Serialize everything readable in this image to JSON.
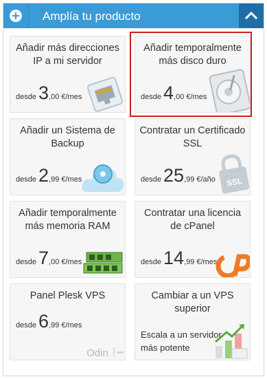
{
  "header": {
    "title": "Amplía tu producto",
    "add_icon": "plus-icon",
    "toggle_icon": "chevron-up-icon",
    "color": "#3b9bd6",
    "toggle_color": "#1f6ea8"
  },
  "highlight_color": "#c9201f",
  "cards": [
    {
      "title": "Añadir más direcciones IP a mi servidor",
      "prefix": "desde",
      "price_int": "3",
      "price_suffix": ",00 €/mes",
      "icon": "network-port-icon"
    },
    {
      "title": "Añadir temporalmente más disco duro",
      "prefix": "desde",
      "price_int": "4",
      "price_suffix": ",00 €/mes",
      "icon": "hard-disk-icon",
      "selected": true
    },
    {
      "title": "Añadir un Sistema de Backup",
      "prefix": "desde",
      "price_int": "2",
      "price_suffix": ",99 €/mes",
      "icon": "cloud-backup-icon"
    },
    {
      "title": "Contratar un Certificado SSL",
      "prefix": "desde",
      "price_int": "25",
      "price_suffix": ",99 €/año",
      "icon": "ssl-lock-icon"
    },
    {
      "title": "Añadir temporalmente más memoria RAM",
      "prefix": "desde",
      "price_int": "7",
      "price_suffix": ",00 €/mes",
      "icon": "ram-module-icon"
    },
    {
      "title": "Contratar una licencia de cPanel",
      "prefix": "desde",
      "price_int": "14",
      "price_suffix": ",99 €/mes",
      "icon": "cpanel-logo-icon"
    },
    {
      "title": "Panel Plesk VPS",
      "prefix": "desde",
      "price_int": "6",
      "price_suffix": ",99 €/mes",
      "icon": "odin-plesk-logo-icon",
      "logo_text": "Odin"
    },
    {
      "title": "Cambiar a un VPS superior",
      "description": "Escala a un servidor más potente",
      "icon": "upgrade-chart-icon"
    }
  ]
}
